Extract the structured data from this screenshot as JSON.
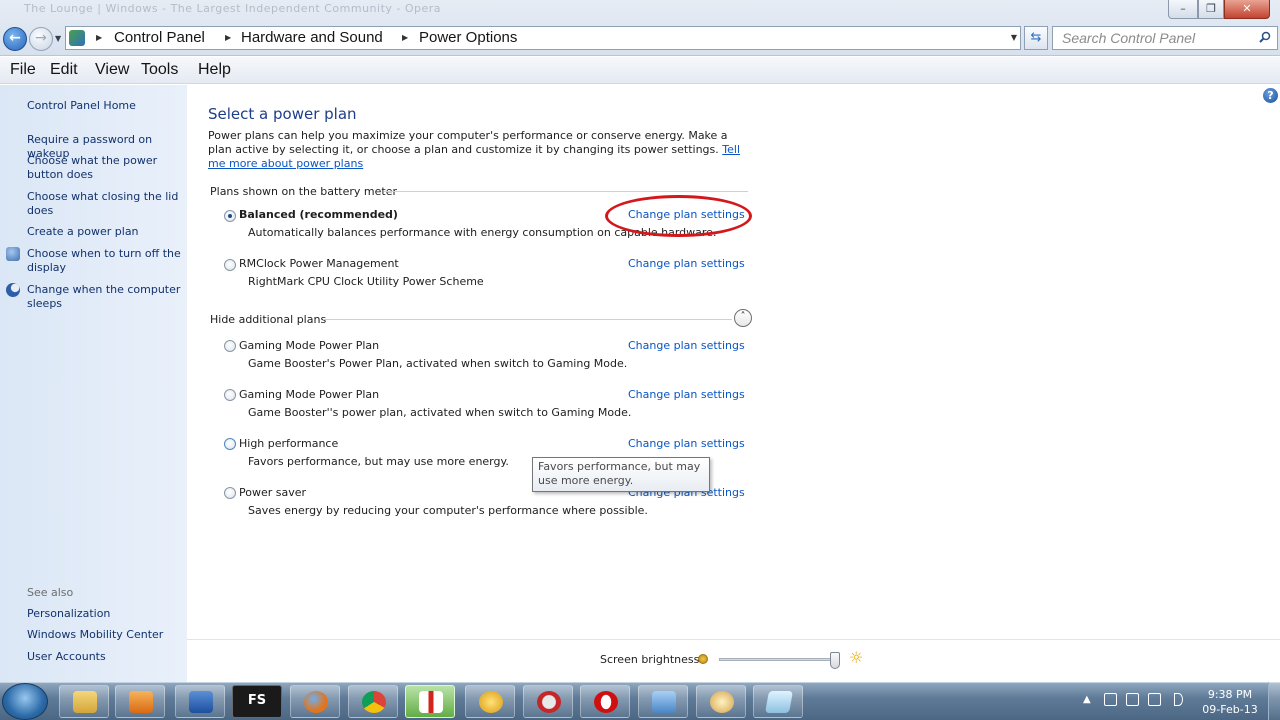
{
  "window": {
    "title_ghost": "The Lounge | Windows - The Largest Independent Community - Opera",
    "min_glyph": "–",
    "max_glyph": "❐",
    "close_glyph": "✕"
  },
  "nav": {
    "back_glyph": "←",
    "forward_glyph": "→",
    "history_glyph": "▼",
    "refresh_glyph": "⇆"
  },
  "address": {
    "crumbs": [
      "Control Panel",
      "Hardware and Sound",
      "Power Options"
    ],
    "separator": "▶",
    "dropdown": "▼"
  },
  "search": {
    "placeholder": "Search Control Panel"
  },
  "menu": [
    "File",
    "Edit",
    "View",
    "Tools",
    "Help"
  ],
  "sidebar": {
    "home": "Control Panel Home",
    "links": [
      "Require a password on wakeup",
      "Choose what the power button does",
      "Choose what closing the lid does",
      "Create a power plan",
      "Choose when to turn off the display",
      "Change when the computer sleeps"
    ],
    "see_also_label": "See also",
    "see_also": [
      "Personalization",
      "Windows Mobility Center",
      "User Accounts"
    ]
  },
  "main": {
    "help_glyph": "?",
    "title": "Select a power plan",
    "intro": "Power plans can help you maximize your computer's performance or conserve energy. Make a plan active by selecting it, or choose a plan and customize it by changing its power settings.",
    "intro_link": "Tell me more about power plans",
    "section_battery": "Plans shown on the battery meter",
    "section_additional": "Hide additional plans",
    "collapse_glyph": "˄",
    "change_link": "Change plan settings",
    "plans_battery": [
      {
        "name": "Balanced (recommended)",
        "desc": "Automatically balances performance with energy consumption on capable hardware.",
        "selected": true
      },
      {
        "name": "RMClock Power Management",
        "desc": "RightMark CPU Clock Utility Power Scheme",
        "selected": false
      }
    ],
    "plans_additional": [
      {
        "name": "Gaming Mode Power Plan",
        "desc": "Game Booster's Power Plan, activated when switch to Gaming Mode.",
        "selected": false
      },
      {
        "name": "Gaming Mode Power Plan",
        "desc": "Game Booster''s power plan, activated when switch to Gaming Mode.",
        "selected": false
      },
      {
        "name": "High performance",
        "desc": "Favors performance, but may use more energy.",
        "selected": false
      },
      {
        "name": "Power saver",
        "desc": "Saves energy by reducing your computer's performance where possible.",
        "selected": false
      }
    ],
    "tooltip": "Favors performance, but may use more energy.",
    "brightness_label": "Screen brightness:",
    "brightness_level": 0.98,
    "bright_glyph": "☼"
  },
  "taskbar": {
    "apps": [
      "explorer",
      "media-player",
      "word",
      "FS",
      "firefox",
      "chrome",
      "thermometer",
      "game-booster",
      "speedometer",
      "opera",
      "control-panel",
      "paint",
      "notepad"
    ],
    "fs_label": "FS",
    "tray_arrow": "▲",
    "time": "9:38 PM",
    "date": "09-Feb-13"
  },
  "colors": {
    "link": "#0a55c4",
    "title": "#1e3d8a",
    "highlight": "#d3171b"
  }
}
